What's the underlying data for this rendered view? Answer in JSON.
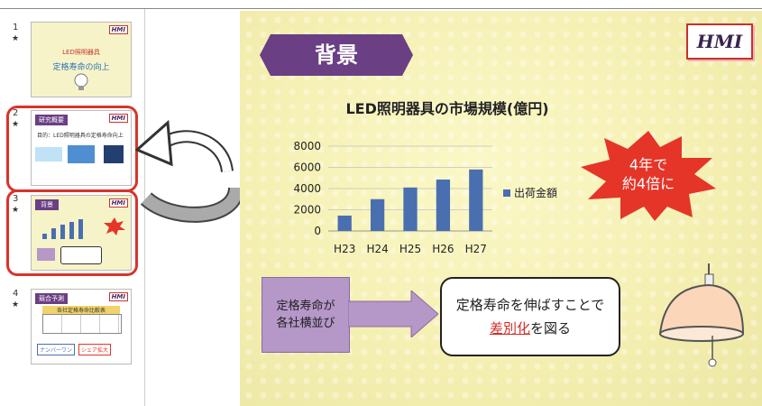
{
  "thumbnails": [
    {
      "num": "1",
      "star": "★",
      "title": "LED照明器具",
      "subtitle": "定格寿命の向上"
    },
    {
      "num": "2",
      "star": "★",
      "title": "研究概要",
      "body": "目的：LED照明器具の定格寿命向上"
    },
    {
      "num": "3",
      "star": "★",
      "title": "背景"
    },
    {
      "num": "4",
      "star": "★",
      "title": "競合予測",
      "table_title": "各社定格寿命比較表",
      "nb1": "ナンバーワン",
      "nb2": "シェア拡大"
    }
  ],
  "slide": {
    "title": "背景",
    "logo": "HMI",
    "burst_line1": "4年で",
    "burst_line2": "約4倍に",
    "left_box_line1": "定格寿命が",
    "left_box_line2": "各社横並び",
    "right_box_line1": "定格寿命を伸ばすことで",
    "right_box_emph": "差別化",
    "right_box_rest": "を図る"
  },
  "colors": {
    "title_badge": "#6b3f84",
    "bar": "#4a6fb0",
    "burst": "#e53528",
    "highlight": "#d9342b",
    "left_box": "#b597c8"
  },
  "chart_data": {
    "type": "bar",
    "title": "LED照明器具の市場規模(億円)",
    "categories": [
      "H23",
      "H24",
      "H25",
      "H26",
      "H27"
    ],
    "series": [
      {
        "name": "出荷金額",
        "values": [
          1450,
          3000,
          4100,
          4850,
          5800
        ]
      }
    ],
    "yticks": [
      0,
      2000,
      4000,
      6000,
      8000
    ],
    "ylim": [
      0,
      8000
    ],
    "grid": true,
    "legend": "right"
  }
}
